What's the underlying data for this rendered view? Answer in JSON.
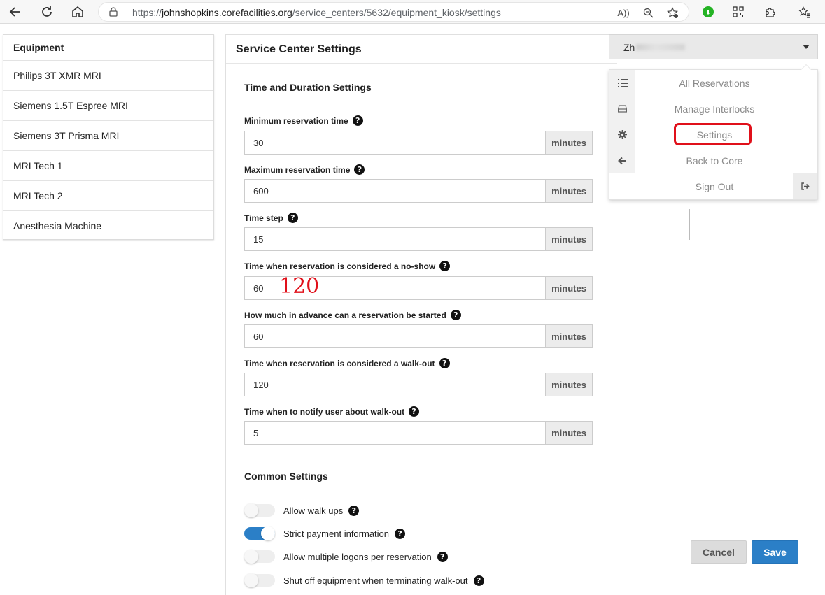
{
  "browser": {
    "url_prefix": "https://",
    "url_domain": "johnshopkins.corefacilities.org",
    "url_path": "/service_centers/5632/equipment_kiosk/settings",
    "read_aloud_icon": "A))"
  },
  "equipment": {
    "title": "Equipment",
    "items": [
      "Philips 3T XMR MRI",
      "Siemens 1.5T Espree MRI",
      "Siemens 3T Prisma MRI",
      "MRI Tech 1",
      "MRI Tech 2",
      "Anesthesia Machine"
    ]
  },
  "settings": {
    "title": "Service Center Settings",
    "time_section_title": "Time and Duration Settings",
    "unit": "minutes",
    "fields": [
      {
        "label": "Minimum reservation time",
        "value": "30"
      },
      {
        "label": "Maximum reservation time",
        "value": "600"
      },
      {
        "label": "Time step",
        "value": "15"
      },
      {
        "label": "Time when reservation is considered a no-show",
        "value": "60"
      },
      {
        "label": "How much in advance can a reservation be started",
        "value": "60"
      },
      {
        "label": "Time when reservation is considered a walk-out",
        "value": "120"
      },
      {
        "label": "Time when to notify user about walk-out",
        "value": "5"
      }
    ],
    "annotation": "120",
    "common_section_title": "Common Settings",
    "toggles": [
      {
        "label": "Allow walk ups",
        "on": false
      },
      {
        "label": "Strict payment information",
        "on": true
      },
      {
        "label": "Allow multiple logons per reservation",
        "on": false
      },
      {
        "label": "Shut off equipment when terminating walk-out",
        "on": false
      }
    ]
  },
  "user_menu": {
    "user_name_visible": "Zh",
    "items": [
      "All Reservations",
      "Manage Interlocks",
      "Settings",
      "Back to Core",
      "Sign Out"
    ]
  },
  "actions": {
    "cancel_label": "Cancel",
    "save_label": "Save"
  },
  "colors": {
    "accent": "#2b7fc7",
    "highlight": "#e0101a"
  }
}
